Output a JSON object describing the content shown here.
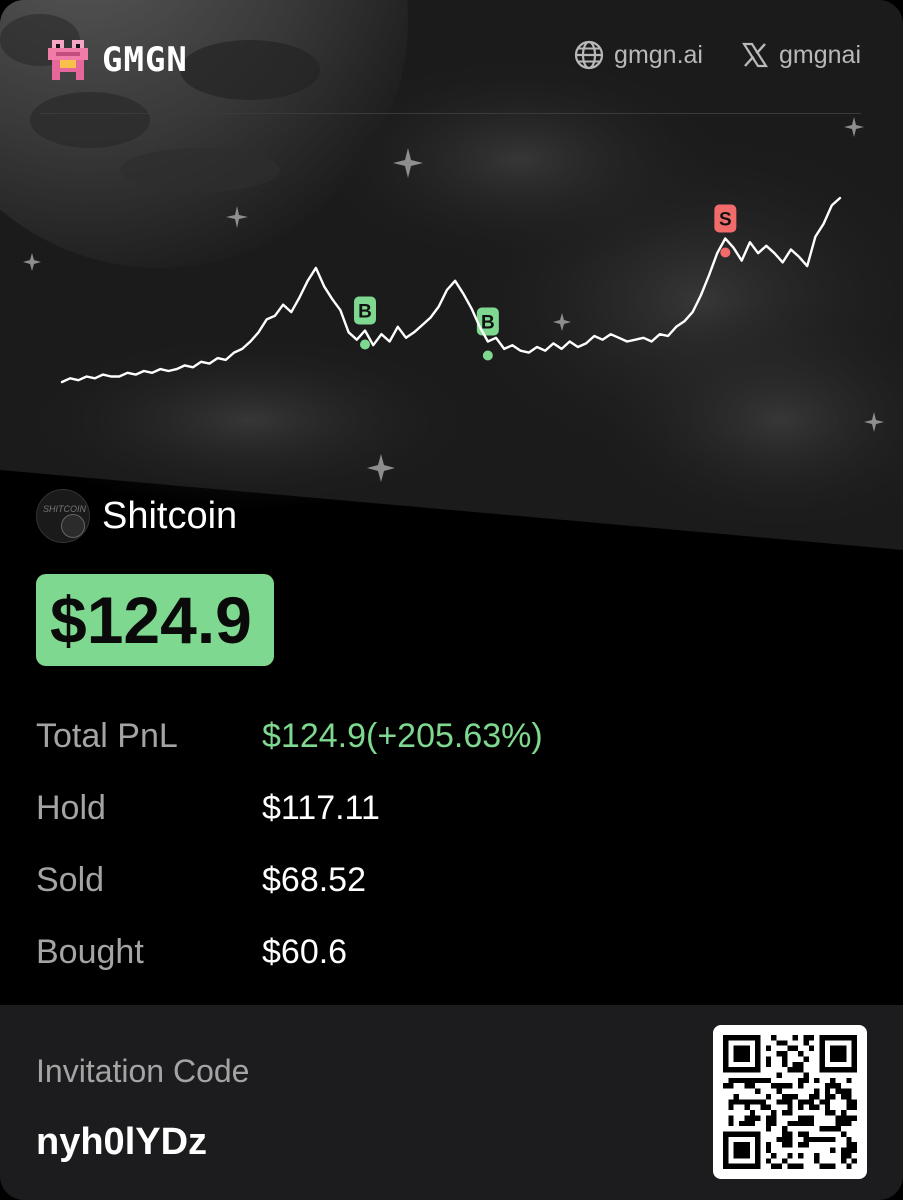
{
  "brand": {
    "name": "GMGN"
  },
  "header": {
    "links": [
      {
        "icon": "globe-icon",
        "label": "gmgn.ai"
      },
      {
        "icon": "x-logo-icon",
        "label": "gmgnai"
      }
    ]
  },
  "chart_data": {
    "type": "line",
    "y": [
      0.0,
      0.02,
      0.01,
      0.03,
      0.02,
      0.04,
      0.03,
      0.03,
      0.05,
      0.04,
      0.06,
      0.05,
      0.07,
      0.06,
      0.07,
      0.09,
      0.08,
      0.11,
      0.1,
      0.13,
      0.12,
      0.16,
      0.18,
      0.22,
      0.27,
      0.34,
      0.36,
      0.42,
      0.38,
      0.46,
      0.55,
      0.62,
      0.52,
      0.45,
      0.39,
      0.27,
      0.23,
      0.28,
      0.2,
      0.26,
      0.22,
      0.3,
      0.24,
      0.27,
      0.31,
      0.35,
      0.41,
      0.5,
      0.55,
      0.48,
      0.4,
      0.3,
      0.22,
      0.24,
      0.18,
      0.2,
      0.17,
      0.16,
      0.19,
      0.17,
      0.21,
      0.18,
      0.22,
      0.19,
      0.21,
      0.25,
      0.23,
      0.26,
      0.24,
      0.22,
      0.23,
      0.24,
      0.22,
      0.26,
      0.25,
      0.3,
      0.33,
      0.38,
      0.47,
      0.58,
      0.7,
      0.78,
      0.73,
      0.66,
      0.76,
      0.7,
      0.74,
      0.7,
      0.65,
      0.72,
      0.68,
      0.63,
      0.79,
      0.86,
      0.96,
      1.0
    ],
    "markers": [
      {
        "label": "B",
        "index": 37,
        "color": "#7fd88f"
      },
      {
        "label": "B",
        "index": 52,
        "color": "#7fd88f"
      },
      {
        "label": "S",
        "index": 81,
        "color": "#f26b6b"
      }
    ]
  },
  "token": {
    "name": "Shitcoin",
    "avatar_text": "SHITCOIN"
  },
  "pnl": {
    "amount": "$124.9"
  },
  "stats": [
    {
      "label": "Total PnL",
      "value": "$124.9(+205.63%)"
    },
    {
      "label": "Hold",
      "value": "$117.11"
    },
    {
      "label": "Sold",
      "value": "$68.52"
    },
    {
      "label": "Bought",
      "value": "$60.6"
    }
  ],
  "invitation": {
    "label": "Invitation Code",
    "code": "nyh0lYDz"
  },
  "colors": {
    "accent_green": "#7fd88f",
    "sell_red": "#f26b6b",
    "footer_bg": "#1c1c1e"
  }
}
